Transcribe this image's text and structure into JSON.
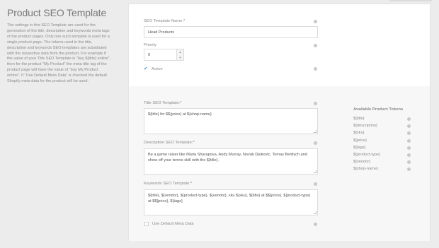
{
  "sidebar": {
    "title": "Product SEO Template",
    "description": "The settings in this SEO Template are used for the generation of the title, description and keywords meta tags of the product pages. Only one such template is used for a single product page. The tokens used in the title, description and keywords SEO templates are substituted with the respective data from the product. For example if the value of your Title SEO Template is \"buy ${title} online\", then for the product \"My Product\" the meta title tag of the product page will have the value of \"buy My Product online\". If \"Use Default Meta Data\" is checked the default Shopify meta data for the product will be used."
  },
  "form": {
    "name_label": "SEO Template Name:*",
    "name_value": "Head Products",
    "priority_label": "Priority",
    "priority_value": "0",
    "active_label": "Active",
    "title_label": "Title SEO Template:*",
    "title_value": "${title} for $${price} at ${shop-name}",
    "description_label": "Description SEO Template:*",
    "description_value": "Be a game raiser like Maria Sharapova, Andy Murray, Novak Djokovic, Tomas Berdych and show off your tennis skill with the ${title}.",
    "keywords_label": "Keywords SEO Template:*",
    "keywords_value": "${title}, ${vendor}, ${product-type}, ${vendor}, sku ${sku}, ${title} at $${price}, ${product-type} at $${price}, ${tags}",
    "default_meta_label": "Use Default Meta Data"
  },
  "tokens": {
    "title": "Available Product Tokens",
    "items": [
      "${title}",
      "${description}",
      "${sku}",
      "${price}",
      "${tags}",
      "${product-type}",
      "${vendor}",
      "${shop-name}"
    ]
  },
  "icons": {
    "info": "info-circle-icon",
    "check": "checkmark-icon",
    "spinner_up": "caret-up-icon",
    "spinner_down": "caret-down-icon"
  },
  "colors": {
    "background": "#ececec",
    "card": "#ffffff",
    "card_lower": "#f7f7f7",
    "accent": "#4a90c9"
  }
}
